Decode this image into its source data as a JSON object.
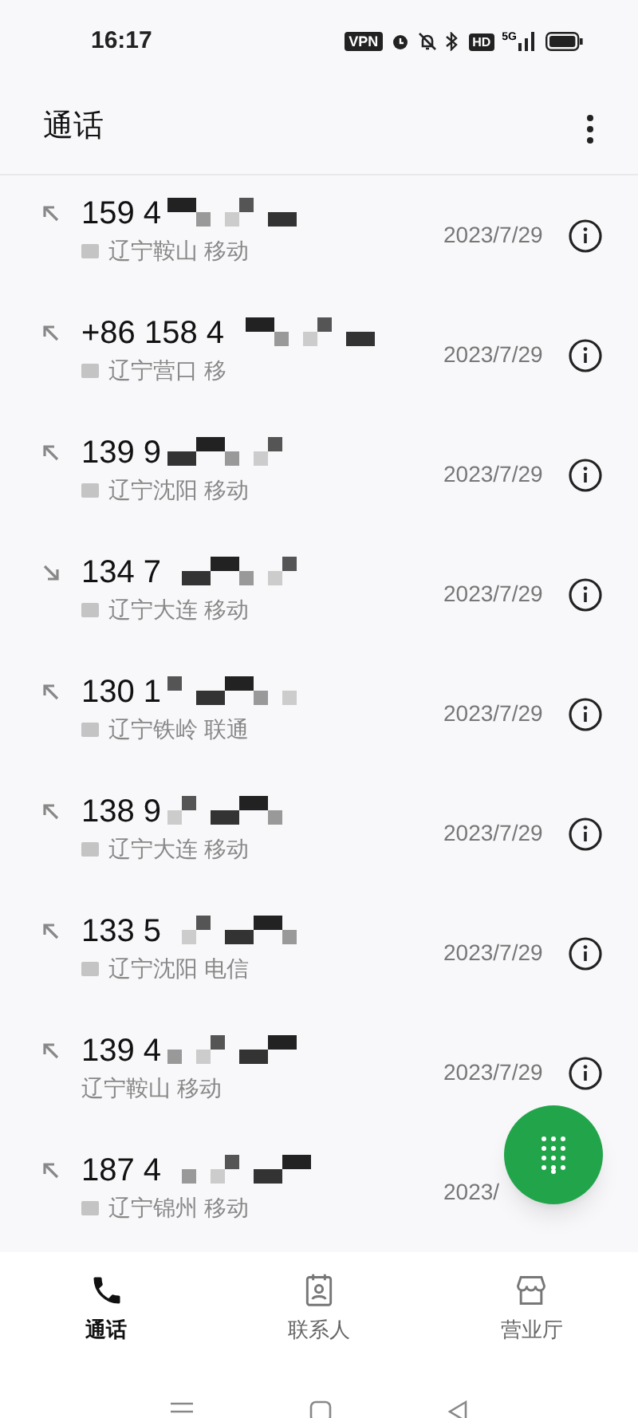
{
  "status_bar": {
    "time": "16:17",
    "vpn": "VPN",
    "hd": "HD",
    "network": "5G"
  },
  "header": {
    "title": "通话"
  },
  "calls": [
    {
      "number": "159 4",
      "location": "辽宁鞍山 移动",
      "date": "2023/7/29",
      "incoming": false,
      "hd": true,
      "info": true
    },
    {
      "number": "+86 158 4",
      "location": "辽宁营口 移",
      "date": "2023/7/29",
      "incoming": false,
      "hd": true,
      "info": true
    },
    {
      "number": "139 9",
      "location": "辽宁沈阳 移动",
      "date": "2023/7/29",
      "incoming": false,
      "hd": true,
      "info": true
    },
    {
      "number": "134 7",
      "location": "辽宁大连 移动",
      "date": "2023/7/29",
      "incoming": true,
      "hd": true,
      "info": true
    },
    {
      "number": "130 1",
      "location": "辽宁铁岭 联通",
      "date": "2023/7/29",
      "incoming": false,
      "hd": true,
      "info": true
    },
    {
      "number": "138 9",
      "location": "辽宁大连 移动",
      "date": "2023/7/29",
      "incoming": false,
      "hd": true,
      "info": true
    },
    {
      "number": "133 5",
      "location": "辽宁沈阳 电信",
      "date": "2023/7/29",
      "incoming": false,
      "hd": true,
      "info": true
    },
    {
      "number": "139 4",
      "location": "辽宁鞍山 移动",
      "date": "2023/7/29",
      "incoming": false,
      "hd": false,
      "info": true
    },
    {
      "number": "187 4",
      "location": "辽宁锦州 移动",
      "date": "2023/",
      "incoming": false,
      "hd": true,
      "info": false
    }
  ],
  "tabs": [
    {
      "label": "通话",
      "kind": "calls",
      "selected": true
    },
    {
      "label": "联系人",
      "kind": "contacts",
      "selected": false
    },
    {
      "label": "营业厅",
      "kind": "store",
      "selected": false
    }
  ]
}
